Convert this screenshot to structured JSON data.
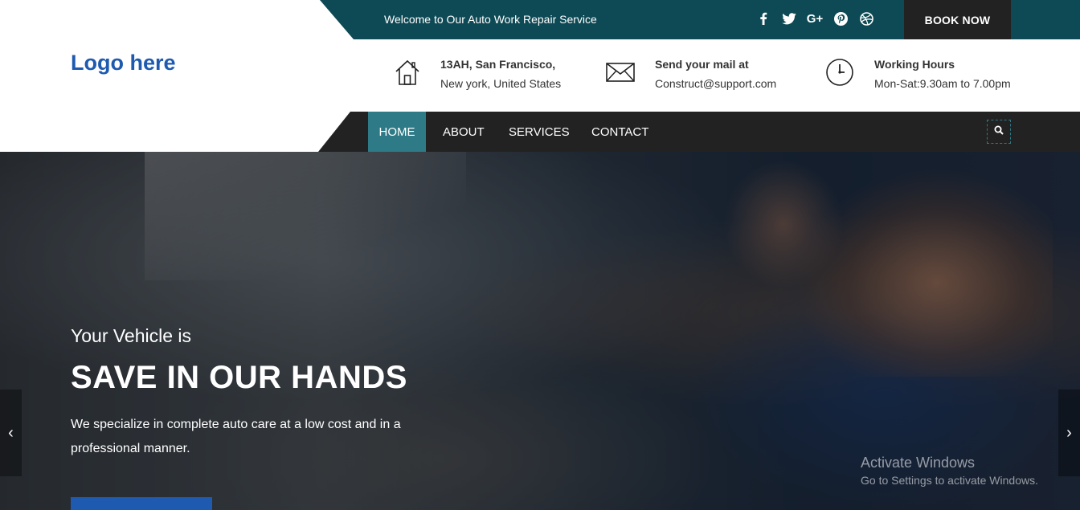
{
  "topbar": {
    "welcome": "Welcome to Our Auto Work Repair Service",
    "social_icons": [
      "facebook-icon",
      "twitter-icon",
      "google-plus-icon",
      "pinterest-icon",
      "dribbble-icon"
    ],
    "book_label": "BOOK NOW"
  },
  "logo": "Logo here",
  "info": {
    "address": {
      "icon": "house-icon",
      "line1": "13AH, San Francisco,",
      "line2": "New york, United States"
    },
    "mail": {
      "icon": "envelope-icon",
      "line1": "Send your mail at",
      "line2": "Construct@support.com"
    },
    "hours": {
      "icon": "clock-icon",
      "line1": "Working Hours",
      "line2": "Mon-Sat:9.30am to 7.00pm"
    }
  },
  "nav": {
    "items": [
      {
        "label": "HOME",
        "active": true
      },
      {
        "label": "ABOUT",
        "active": false
      },
      {
        "label": "SERVICES",
        "active": false
      },
      {
        "label": "CONTACT",
        "active": false
      }
    ],
    "search_icon": "search-icon"
  },
  "hero": {
    "subtitle": "Your Vehicle is",
    "title": "SAVE IN OUR HANDS",
    "description": "We specialize in complete auto care at a low cost and in a professional manner.",
    "prev_label": "‹",
    "next_label": "›"
  },
  "watermark": {
    "line1": "Activate Windows",
    "line2": "Go to Settings to activate Windows."
  },
  "colors": {
    "teal_dark": "#0e4a55",
    "teal_active": "#2e7a86",
    "nav_bg": "#222222",
    "logo_blue": "#1e5bb0"
  }
}
